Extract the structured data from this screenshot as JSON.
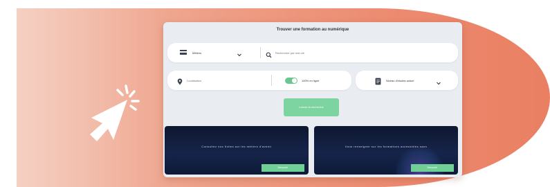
{
  "colors": {
    "banner_start": "#f2c0ae",
    "banner_end": "#ea7f62",
    "accent_green": "#7ed4a0",
    "card_dark": "#0e1730"
  },
  "screen": {
    "title": "Trouver une formation au numérique",
    "row1": {
      "filter_icon": "grid-icon",
      "filter_label": "Métiers",
      "dropdown_icon": "chevron-down-icon",
      "search_icon": "search-icon",
      "search_placeholder": "Rechercher par mot-clé"
    },
    "row2": {
      "location_icon": "location-pin-icon",
      "location_placeholder": "Localisation",
      "toggle_label": "100% en ligne",
      "toggle_on": true,
      "format_icon": "document-icon",
      "format_label": "Niveau d'études actuel"
    },
    "search_button": "Lancer la recherche",
    "cards": [
      {
        "title": "Consultez nos fiches sur les métiers d'avenir",
        "button": "Découvrir"
      },
      {
        "title": "Vous renseigner sur les formations accessibles sans",
        "button": "Découvrir"
      }
    ]
  },
  "decor": {
    "cursor_icon": "pointer-click-icon"
  }
}
